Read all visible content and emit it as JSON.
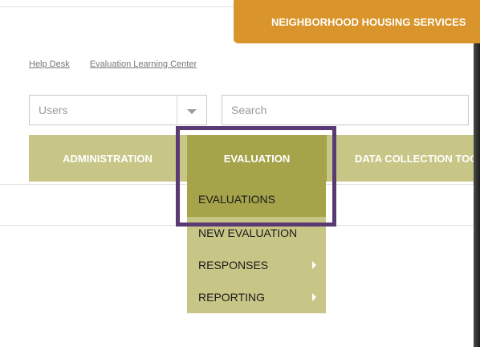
{
  "header": {
    "org_name": "NEIGHBORHOOD HOUSING SERVICES"
  },
  "links": {
    "help_desk": "Help Desk",
    "learning_center": "Evaluation Learning Center"
  },
  "search_bar": {
    "scope_value": "Users",
    "placeholder": "Search"
  },
  "nav": {
    "items": [
      {
        "label": "ADMINISTRATION"
      },
      {
        "label": "EVALUATION"
      },
      {
        "label": "DATA COLLECTION TOOLS"
      }
    ]
  },
  "dropdown": {
    "items": [
      {
        "label": "EVALUATIONS",
        "active": true
      },
      {
        "label": "NEW EVALUATION"
      },
      {
        "label": "RESPONSES",
        "has_submenu": true
      },
      {
        "label": "REPORTING",
        "has_submenu": true
      }
    ]
  },
  "colors": {
    "banner": "#d9952b",
    "nav_bg": "#c8c686",
    "nav_active": "#a6a44a",
    "highlight_border": "#5a3a73"
  }
}
